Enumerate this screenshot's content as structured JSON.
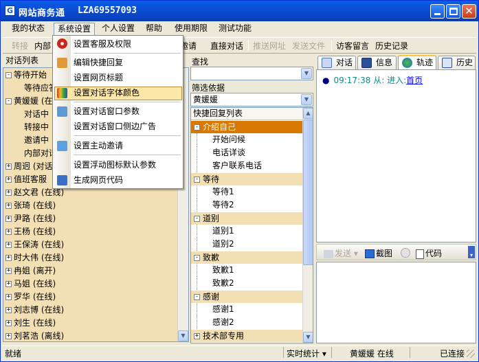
{
  "window": {
    "title": "网站商务通",
    "id_text": "LZA69557093"
  },
  "menubar": {
    "items": [
      "我的状态",
      "系统设置",
      "个人设置",
      "帮助",
      "使用期限",
      "测试功能"
    ]
  },
  "toolbar": {
    "transfer": "转接",
    "internal": "内部",
    "invite": "邀请",
    "direct_chat": "直接对话",
    "push_url": "推送网址",
    "send_file": "发送文件",
    "visitor_msg": "访客留言",
    "history": "历史记录"
  },
  "left": {
    "header": "对话列表",
    "rows": [
      {
        "sign": "⊟",
        "text": "等待开始"
      },
      {
        "sign": "",
        "text": "等待应答"
      },
      {
        "sign": "⊟",
        "text": "黄媛媛 (在"
      },
      {
        "sign": "",
        "text": "对话中"
      },
      {
        "sign": "",
        "text": "转接中"
      },
      {
        "sign": "",
        "text": "邀请中"
      },
      {
        "sign": "",
        "text": "内部对话"
      },
      {
        "sign": "⊞",
        "text": "周迥 (对话"
      },
      {
        "sign": "⊞",
        "text": "值班客服"
      },
      {
        "sign": "⊞",
        "text": "赵文君 (在线)"
      },
      {
        "sign": "⊞",
        "text": "张琦 (在线)"
      },
      {
        "sign": "⊞",
        "text": "尹路 (在线)"
      },
      {
        "sign": "⊞",
        "text": "王杨 (在线)"
      },
      {
        "sign": "⊞",
        "text": "王保涛 (在线)"
      },
      {
        "sign": "⊞",
        "text": "时大伟 (在线)"
      },
      {
        "sign": "⊞",
        "text": "冉姐 (离开)"
      },
      {
        "sign": "⊞",
        "text": "马姐 (在线)"
      },
      {
        "sign": "⊞",
        "text": "罗华 (在线)"
      },
      {
        "sign": "⊞",
        "text": "刘志博 (在线)"
      },
      {
        "sign": "⊞",
        "text": "刘生 (在线)"
      },
      {
        "sign": "⊞",
        "text": "刘茗浩 (离线)"
      }
    ]
  },
  "system_menu": {
    "items": [
      "设置客服及权限",
      "编辑快捷回复",
      "设置网页标题",
      "设置对话字体颜色",
      "设置对话窗口参数",
      "设置对话窗口侧边广告",
      "设置主动邀请",
      "设置浮动图标默认参数",
      "生成网页代码"
    ],
    "highlighted": "设置对话字体颜色"
  },
  "middle": {
    "search_label": "查找",
    "search_value": "",
    "filter_label": "筛选依据",
    "filter_value": "黄媛媛",
    "list_header": "快捷回复列表",
    "groups": [
      {
        "sign": "⊟",
        "name": "介绍自己",
        "selected": true,
        "items": [
          "开始问候",
          "电话详谈",
          "客户联系电话"
        ]
      },
      {
        "sign": "⊟",
        "name": "等待",
        "selected": false,
        "items": [
          "等待1",
          "等待2"
        ]
      },
      {
        "sign": "⊟",
        "name": "道别",
        "selected": false,
        "items": [
          "道别1",
          "道别2"
        ]
      },
      {
        "sign": "⊟",
        "name": "致歉",
        "selected": false,
        "items": [
          "致歉1",
          "致歉2"
        ]
      },
      {
        "sign": "⊟",
        "name": "感谢",
        "selected": false,
        "items": [
          "感谢1",
          "感谢2"
        ]
      },
      {
        "sign": "⊞",
        "name": "技术部专用",
        "selected": false,
        "items": []
      }
    ]
  },
  "right": {
    "tabs": [
      "对话",
      "信息",
      "轨迹",
      "历史"
    ],
    "active_tab": "轨迹",
    "log_time": "09:17:38",
    "log_from": "从: 进入:",
    "log_link": "首页",
    "input_toolbar": {
      "send": "发送",
      "screenshot": "截图",
      "code": "代码"
    }
  },
  "statusbar": {
    "ready": "就绪",
    "stats": "实时统计",
    "user": "黄媛媛 在线",
    "connection": "已连接"
  },
  "colors": {
    "titlebar": "#0a4fd6",
    "tree_bg": "#f2dfb4",
    "group_selected": "#d77800",
    "menu_highlight": "#fce7a8"
  }
}
